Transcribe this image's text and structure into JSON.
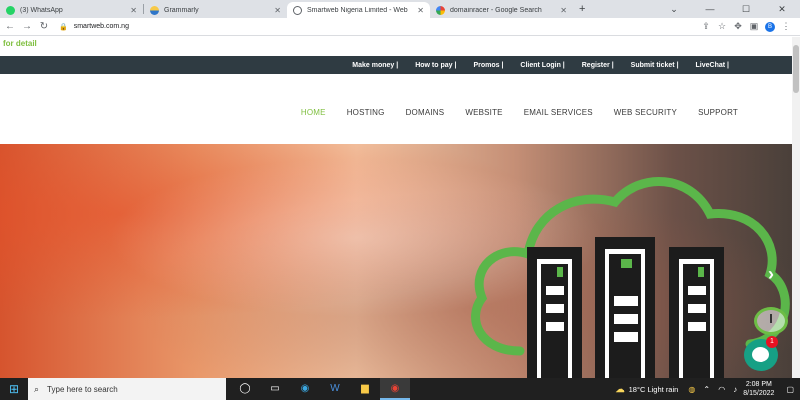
{
  "browser": {
    "tabs": [
      {
        "title": "(3) WhatsApp",
        "icon": "whatsapp-icon",
        "color": "#25d366"
      },
      {
        "title": "Grammarly",
        "icon": "grammarly-icon",
        "color": "#2f76c9"
      },
      {
        "title": "Smartweb Nigeria Limited - Web",
        "icon": "globe-icon",
        "color": "#5f6368"
      },
      {
        "title": "domainracer - Google Search",
        "icon": "google-icon",
        "color": "#4285f4"
      }
    ],
    "active_tab": 2,
    "url": "smartweb.com.ng"
  },
  "page": {
    "notice": "for detail",
    "top_links": [
      "Make money |",
      "How to pay |",
      "Promos |",
      "Client Login |",
      "Register |",
      "Submit ticket |",
      "LiveChat |"
    ],
    "menu": [
      "HOME",
      "HOSTING",
      "DOMAINS",
      "WEBSITE",
      "EMAIL SERVICES",
      "WEB SECURITY",
      "SUPPORT"
    ],
    "menu_active": "HOME",
    "accent_color": "#7fbf3f",
    "chat_badge": "1"
  },
  "taskbar": {
    "search_placeholder": "Type here to search",
    "weather": "18°C  Light rain",
    "time": "2:08 PM",
    "date": "8/15/2022"
  }
}
